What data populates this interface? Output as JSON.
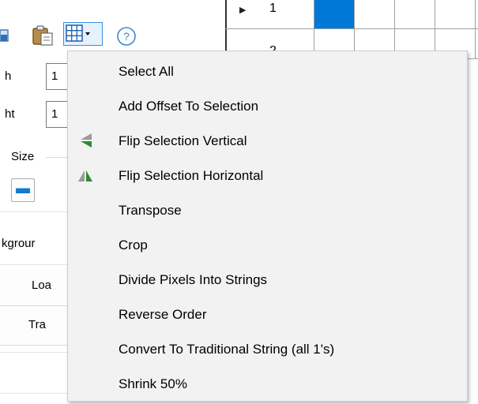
{
  "toolbar": {
    "icons": [
      "document-icon",
      "paste-icon",
      "grid-icon",
      "help-icon"
    ],
    "help_glyph": "?"
  },
  "left_panel": {
    "width_label": "h",
    "width_value": "1",
    "height_label": "ht",
    "height_value": "1",
    "size_label": "Size",
    "background_label": "kgrour",
    "load_button": "Loa",
    "tra_button": "Tra"
  },
  "grid": {
    "row1_label": "1",
    "row2_label": "2",
    "selected_color": "#0078d7"
  },
  "menu": {
    "items": [
      {
        "label": "Select All",
        "icon": ""
      },
      {
        "label": "Add Offset To Selection",
        "icon": ""
      },
      {
        "label": "Flip Selection Vertical",
        "icon": "flip-vertical-icon"
      },
      {
        "label": "Flip Selection Horizontal",
        "icon": "flip-horizontal-icon"
      },
      {
        "label": "Transpose",
        "icon": ""
      },
      {
        "label": "Crop",
        "icon": ""
      },
      {
        "label": "Divide Pixels Into Strings",
        "icon": ""
      },
      {
        "label": "Reverse Order",
        "icon": ""
      },
      {
        "label": "Convert To Traditional String (all 1's)",
        "icon": ""
      },
      {
        "label": "Shrink 50%",
        "icon": ""
      }
    ]
  },
  "colors": {
    "accent": "#0078d7",
    "menu_background": "#f2f2f2",
    "flip_icon_green": "#2e8b2e"
  }
}
